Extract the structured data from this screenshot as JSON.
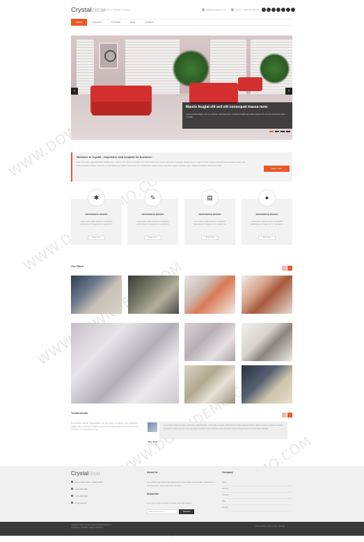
{
  "header": {
    "logo_main": "Crystal",
    "logo_light": "clear",
    "tagline": "Responsive Website Template",
    "email": "info@crystalclear.com",
    "phone": "Call us: + 000 123 456 78",
    "social_icons": [
      "facebook-icon",
      "twitter-icon",
      "linkedin-icon",
      "vimeo-icon",
      "flickr-icon",
      "pinterest-icon",
      "rss-icon"
    ]
  },
  "nav": {
    "items": [
      "Home",
      "Features",
      "Portfolio",
      "Blog",
      "Contact"
    ],
    "active": "Home"
  },
  "slider": {
    "caption_title": "Mauris feugiat elit sed elit consequat massa nunc",
    "caption_text": "Lorem porttitor aliquet nunc pro pulvinar nulla placerat ut. Tincidunt fringilla eget tellus magna enim non est scelerisque dolor convallis.",
    "prev": "‹",
    "next": "›",
    "slide_count": 4,
    "active_slide": 1
  },
  "welcome": {
    "title": "Welcome to Crystal - responsive web template for business!",
    "text": "Proin arcu tellus, placerat facilisis tristique eget, mollis ut odio. Donec accumsan nisi in elit condimentum dictum placerat nisl egestas. Quisque auctor magna id dolor suscipit eu facilisis lorem tincidunt. Nunc nulla tellus, pharetra tincidunt, fermentum ut nisl. Maecenas sodales tellus nisi at orci condimentum feugiat. Donec eget felis magna, id facilisis quam. Maecenas blandit condimentum velit.",
    "button": "Learn more"
  },
  "features": [
    {
      "icon": "tools-icon",
      "glyph": "✱",
      "title": "RESPONSIVE DESIGN",
      "text": "Lorem ipsum dolor sit amet, consectetur adipiscing elit. Integer est mi, egestas id.",
      "button": "Read more"
    },
    {
      "icon": "document-icon",
      "glyph": "✎",
      "title": "RESPONSIVE DESIGN",
      "text": "Lorem ipsum dolor sit amet, consectetur adipiscing elit. Integer est mi, egestas id.",
      "button": "Read more"
    },
    {
      "icon": "chat-icon",
      "glyph": "▤",
      "title": "RESPONSIVE DESIGN",
      "text": "Lorem ipsum dolor sit amet, consectetur adipiscing elit. Integer est mi, egestas id.",
      "button": "Read more"
    },
    {
      "icon": "globe-icon",
      "glyph": "●",
      "title": "RESPONSIVE DESIGN",
      "text": "Lorem ipsum dolor sit amet, consectetur adipiscing elit. Integer est mi, egestas id.",
      "button": "Read more"
    }
  ],
  "work": {
    "title": "Our Work",
    "prev": "‹",
    "next": "›"
  },
  "testimonials": {
    "title": "Testimonials",
    "intro": "Suspendisse blandit. Suspendisse non sem lacus, eu sapien, nam vestibulum sagittis nisi ut hendrerit. Nullam id purus quis odio gravida. Sed viverra nisl mi, a pulvinar ut et dignissim est ac.",
    "quote": "Lorem ipsum dolor sit amet, consectetur adipiscing elit. Ut id turpis in massa. Nulla vel leo id dolor aliquam ultrices. Mauris a lorem ut turpis imperdiet elementum. Donec tempus ante eget ipsum hendrerit vitae molestie mauris convallis. Cras consequat quam sit amet dolor volutpat.",
    "author": "Jhon Doe",
    "author_role": "Company Inc.",
    "prev": "‹",
    "next": "›"
  },
  "footer": {
    "logo_main": "Crystal",
    "logo_light": "clear",
    "contact": [
      {
        "icon": "location-icon",
        "text": "Street Name 00/11, London 76573"
      },
      {
        "icon": "phone-icon",
        "text": "(123) 456-7890"
      },
      {
        "icon": "fax-icon",
        "text": "(123) 456-7890"
      },
      {
        "icon": "mail-icon",
        "text": "info@mail.com"
      }
    ],
    "about_title": "About Us",
    "about_text": "Sed ultricies eget sapien eget ligula facilisis vitae. Etiam vel est mattis, mollis lorem ut, volutpat neque. Donec accumsan faucibus.",
    "subscribe_title": "Subscribe",
    "subscribe_text": "Enter your email to receive our latest news and updates.",
    "email_placeholder": "Enter Email Address",
    "subscribe_button": "Subscribe",
    "company_title": "Company",
    "company_links": [
      "About",
      "Partners",
      "Services",
      "Blog",
      "Contact"
    ]
  },
  "bottom": {
    "copyright": "Copyright © 2013 Company Name All Rights Reserved",
    "template_by": "Template by: Phil Mills | Images: PhotoDune",
    "links": "Privacy Policy · Terms of Use · Sitemap"
  },
  "watermark": "WWW.DOWNDEMO.COM"
}
